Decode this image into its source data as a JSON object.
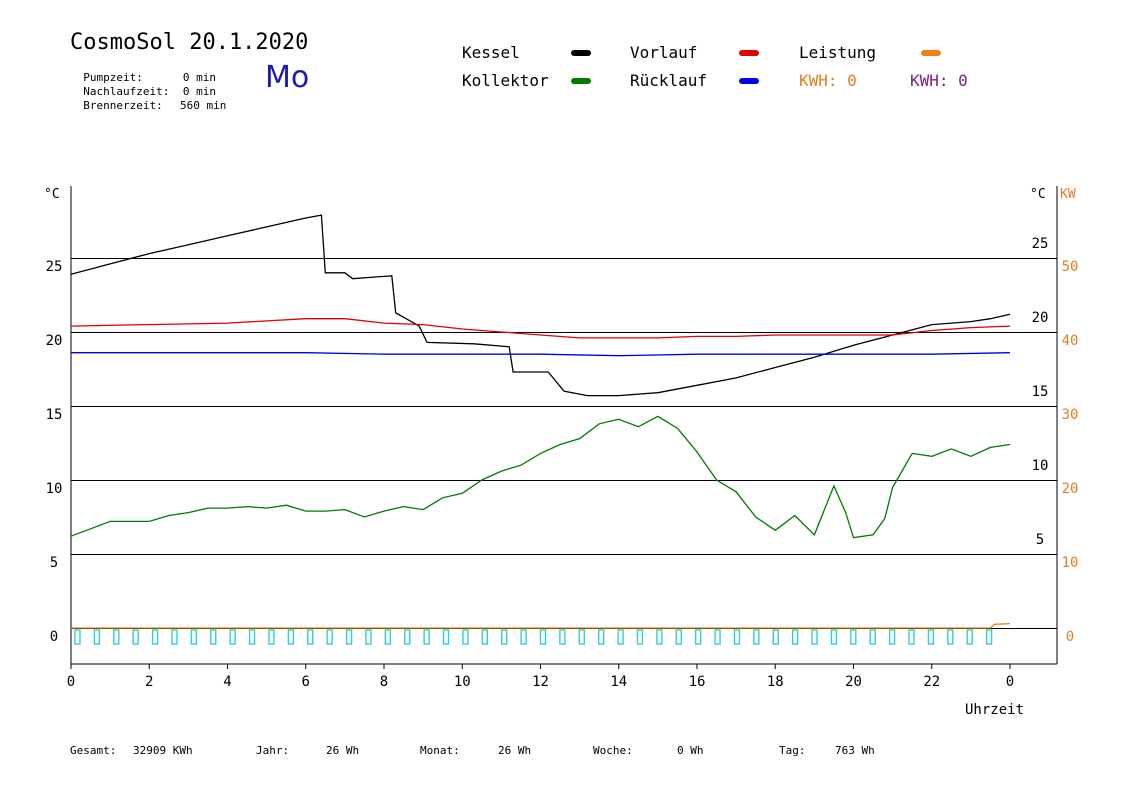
{
  "header": {
    "title": "CosmoSol 20.1.2020",
    "day": "Mo",
    "info": [
      {
        "label": "Pumpzeit:",
        "value": "0 min"
      },
      {
        "label": "Nachlaufzeit:",
        "value": "0 min"
      },
      {
        "label": "Brennerzeit:",
        "value": "560 min"
      }
    ]
  },
  "legend": {
    "kessel": {
      "label": "Kessel",
      "color": "#000000"
    },
    "vorlauf": {
      "label": "Vorlauf",
      "color": "#e00000"
    },
    "leistung": {
      "label": "Leistung",
      "color": "#f08010"
    },
    "kollektor": {
      "label": "Kollektor",
      "color": "#007a00"
    },
    "ruecklauf": {
      "label": "Rücklauf",
      "color": "#0000e0"
    },
    "kwh1": {
      "label": "KWH: 0",
      "color": "#e08020"
    },
    "kwh2": {
      "label": "KWH: 0",
      "color": "#802080"
    }
  },
  "footer": {
    "gesamt": {
      "label": "Gesamt:",
      "value": "32909 KWh"
    },
    "jahr": {
      "label": "Jahr:",
      "value": "26 Wh"
    },
    "monat": {
      "label": "Monat:",
      "value": "26 Wh"
    },
    "woche": {
      "label": "Woche:",
      "value": "0 Wh"
    },
    "tag": {
      "label": "Tag:",
      "value": "763 Wh"
    }
  },
  "chart_data": {
    "type": "line",
    "xlabel": "Uhrzeit",
    "ylabel_left": "°C",
    "ylabel_right_temp": "°C",
    "ylabel_right_power": "KW",
    "x_range": [
      0,
      24
    ],
    "y_range": [
      0,
      30
    ],
    "x_ticks": [
      "0",
      "2",
      "4",
      "6",
      "8",
      "10",
      "12",
      "14",
      "16",
      "18",
      "20",
      "22",
      "0"
    ],
    "y_ticks_left": [
      "0",
      "5",
      "10",
      "15",
      "20",
      "25"
    ],
    "y_ticks_right": [
      "5",
      "10",
      "15",
      "20",
      "25"
    ],
    "y_ticks_power": [
      "0",
      "10",
      "20",
      "30",
      "40",
      "50"
    ],
    "gridlines": [
      5,
      10,
      15,
      20,
      25
    ],
    "series": [
      {
        "name": "Kessel",
        "color": "#000000",
        "points": [
          [
            0,
            23.9
          ],
          [
            1,
            24.6
          ],
          [
            2,
            25.3
          ],
          [
            3,
            25.9
          ],
          [
            4,
            26.5
          ],
          [
            5,
            27.1
          ],
          [
            6,
            27.7
          ],
          [
            6.4,
            27.9
          ],
          [
            6.5,
            24.0
          ],
          [
            7.0,
            24.0
          ],
          [
            7.2,
            23.6
          ],
          [
            8.2,
            23.8
          ],
          [
            8.3,
            21.3
          ],
          [
            8.9,
            20.4
          ],
          [
            9.1,
            19.3
          ],
          [
            10.3,
            19.2
          ],
          [
            11.2,
            19.0
          ],
          [
            11.3,
            17.3
          ],
          [
            12.2,
            17.3
          ],
          [
            12.6,
            16.0
          ],
          [
            13.2,
            15.7
          ],
          [
            14,
            15.7
          ],
          [
            15,
            15.9
          ],
          [
            16,
            16.4
          ],
          [
            17,
            16.9
          ],
          [
            18,
            17.6
          ],
          [
            19,
            18.3
          ],
          [
            20,
            19.1
          ],
          [
            21,
            19.8
          ],
          [
            22,
            20.5
          ],
          [
            23,
            20.7
          ],
          [
            23.5,
            20.9
          ],
          [
            24,
            21.2
          ]
        ]
      },
      {
        "name": "Vorlauf",
        "color": "#e00000",
        "points": [
          [
            0,
            20.4
          ],
          [
            2,
            20.5
          ],
          [
            4,
            20.6
          ],
          [
            6,
            20.9
          ],
          [
            7,
            20.9
          ],
          [
            8,
            20.6
          ],
          [
            9,
            20.5
          ],
          [
            10,
            20.2
          ],
          [
            11,
            20.0
          ],
          [
            12,
            19.8
          ],
          [
            13,
            19.6
          ],
          [
            14,
            19.6
          ],
          [
            15,
            19.6
          ],
          [
            16,
            19.7
          ],
          [
            17,
            19.7
          ],
          [
            18,
            19.8
          ],
          [
            19,
            19.8
          ],
          [
            20,
            19.8
          ],
          [
            21,
            19.8
          ],
          [
            22,
            20.1
          ],
          [
            23,
            20.3
          ],
          [
            24,
            20.4
          ]
        ]
      },
      {
        "name": "Rücklauf",
        "color": "#0000e0",
        "points": [
          [
            0,
            18.6
          ],
          [
            4,
            18.6
          ],
          [
            6,
            18.6
          ],
          [
            8,
            18.5
          ],
          [
            10,
            18.5
          ],
          [
            12,
            18.5
          ],
          [
            14,
            18.4
          ],
          [
            16,
            18.5
          ],
          [
            18,
            18.5
          ],
          [
            20,
            18.5
          ],
          [
            22,
            18.5
          ],
          [
            24,
            18.6
          ]
        ]
      },
      {
        "name": "Kollektor",
        "color": "#007a00",
        "points": [
          [
            0,
            6.2
          ],
          [
            0.5,
            6.7
          ],
          [
            1,
            7.2
          ],
          [
            1.5,
            7.2
          ],
          [
            2,
            7.2
          ],
          [
            2.5,
            7.6
          ],
          [
            3,
            7.8
          ],
          [
            3.5,
            8.1
          ],
          [
            4,
            8.1
          ],
          [
            4.5,
            8.2
          ],
          [
            5,
            8.1
          ],
          [
            5.5,
            8.3
          ],
          [
            6,
            7.9
          ],
          [
            6.5,
            7.9
          ],
          [
            7,
            8.0
          ],
          [
            7.5,
            7.5
          ],
          [
            8,
            7.9
          ],
          [
            8.5,
            8.2
          ],
          [
            9,
            8.0
          ],
          [
            9.5,
            8.8
          ],
          [
            10,
            9.1
          ],
          [
            10.5,
            10.0
          ],
          [
            11,
            10.6
          ],
          [
            11.5,
            11.0
          ],
          [
            12,
            11.8
          ],
          [
            12.5,
            12.4
          ],
          [
            13,
            12.8
          ],
          [
            13.5,
            13.8
          ],
          [
            14,
            14.1
          ],
          [
            14.5,
            13.6
          ],
          [
            15,
            14.3
          ],
          [
            15.5,
            13.5
          ],
          [
            16,
            11.9
          ],
          [
            16.5,
            10.0
          ],
          [
            17,
            9.2
          ],
          [
            17.5,
            7.5
          ],
          [
            18,
            6.6
          ],
          [
            18.5,
            7.6
          ],
          [
            19,
            6.3
          ],
          [
            19.5,
            9.6
          ],
          [
            19.8,
            7.8
          ],
          [
            20,
            6.1
          ],
          [
            20.5,
            6.3
          ],
          [
            20.8,
            7.4
          ],
          [
            21,
            9.5
          ],
          [
            21.5,
            11.8
          ],
          [
            22,
            11.6
          ],
          [
            22.5,
            12.1
          ],
          [
            23,
            11.6
          ],
          [
            23.5,
            12.2
          ],
          [
            24,
            12.4
          ]
        ]
      },
      {
        "name": "Leistung",
        "color": "#f08010",
        "points": [
          [
            0,
            0
          ],
          [
            23.5,
            0
          ],
          [
            23.6,
            0.25
          ],
          [
            24,
            0.3
          ]
        ]
      }
    ],
    "pulse_series": {
      "color": "#30d0d0",
      "pulses": 48
    }
  }
}
